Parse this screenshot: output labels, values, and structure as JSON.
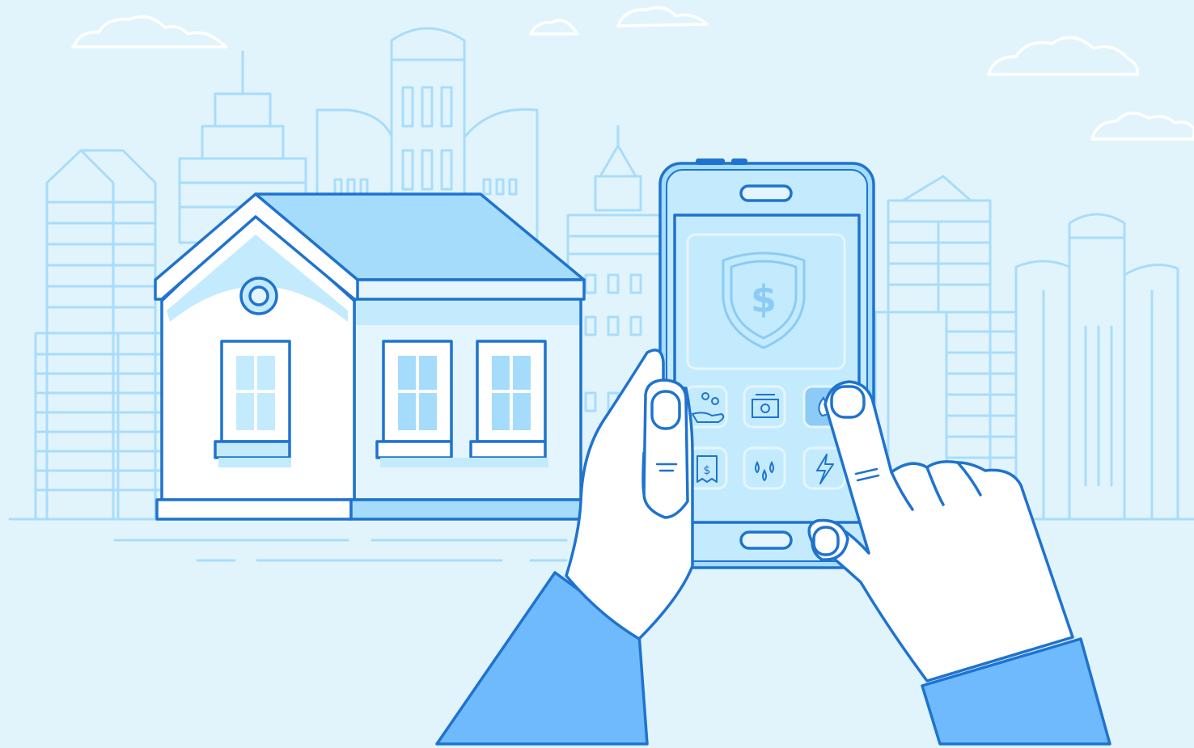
{
  "scene": {
    "background_color": "#e1f4fc",
    "line_color": "#a9dcfb",
    "ink_color": "#1f73cf",
    "fill_light": "#c3ebfd",
    "fill_mid": "#a5dcfc",
    "fill_sleeve": "#6fbafc"
  },
  "phone": {
    "hero_icon": "shield-dollar-icon",
    "app_icons": [
      "coins-hand-icon",
      "cash-icon",
      "flame-icon",
      "receipt-dollar-icon",
      "water-drops-icon",
      "lightning-icon"
    ]
  },
  "house": {
    "window_count": 3,
    "round_window_icon": "round-window"
  }
}
